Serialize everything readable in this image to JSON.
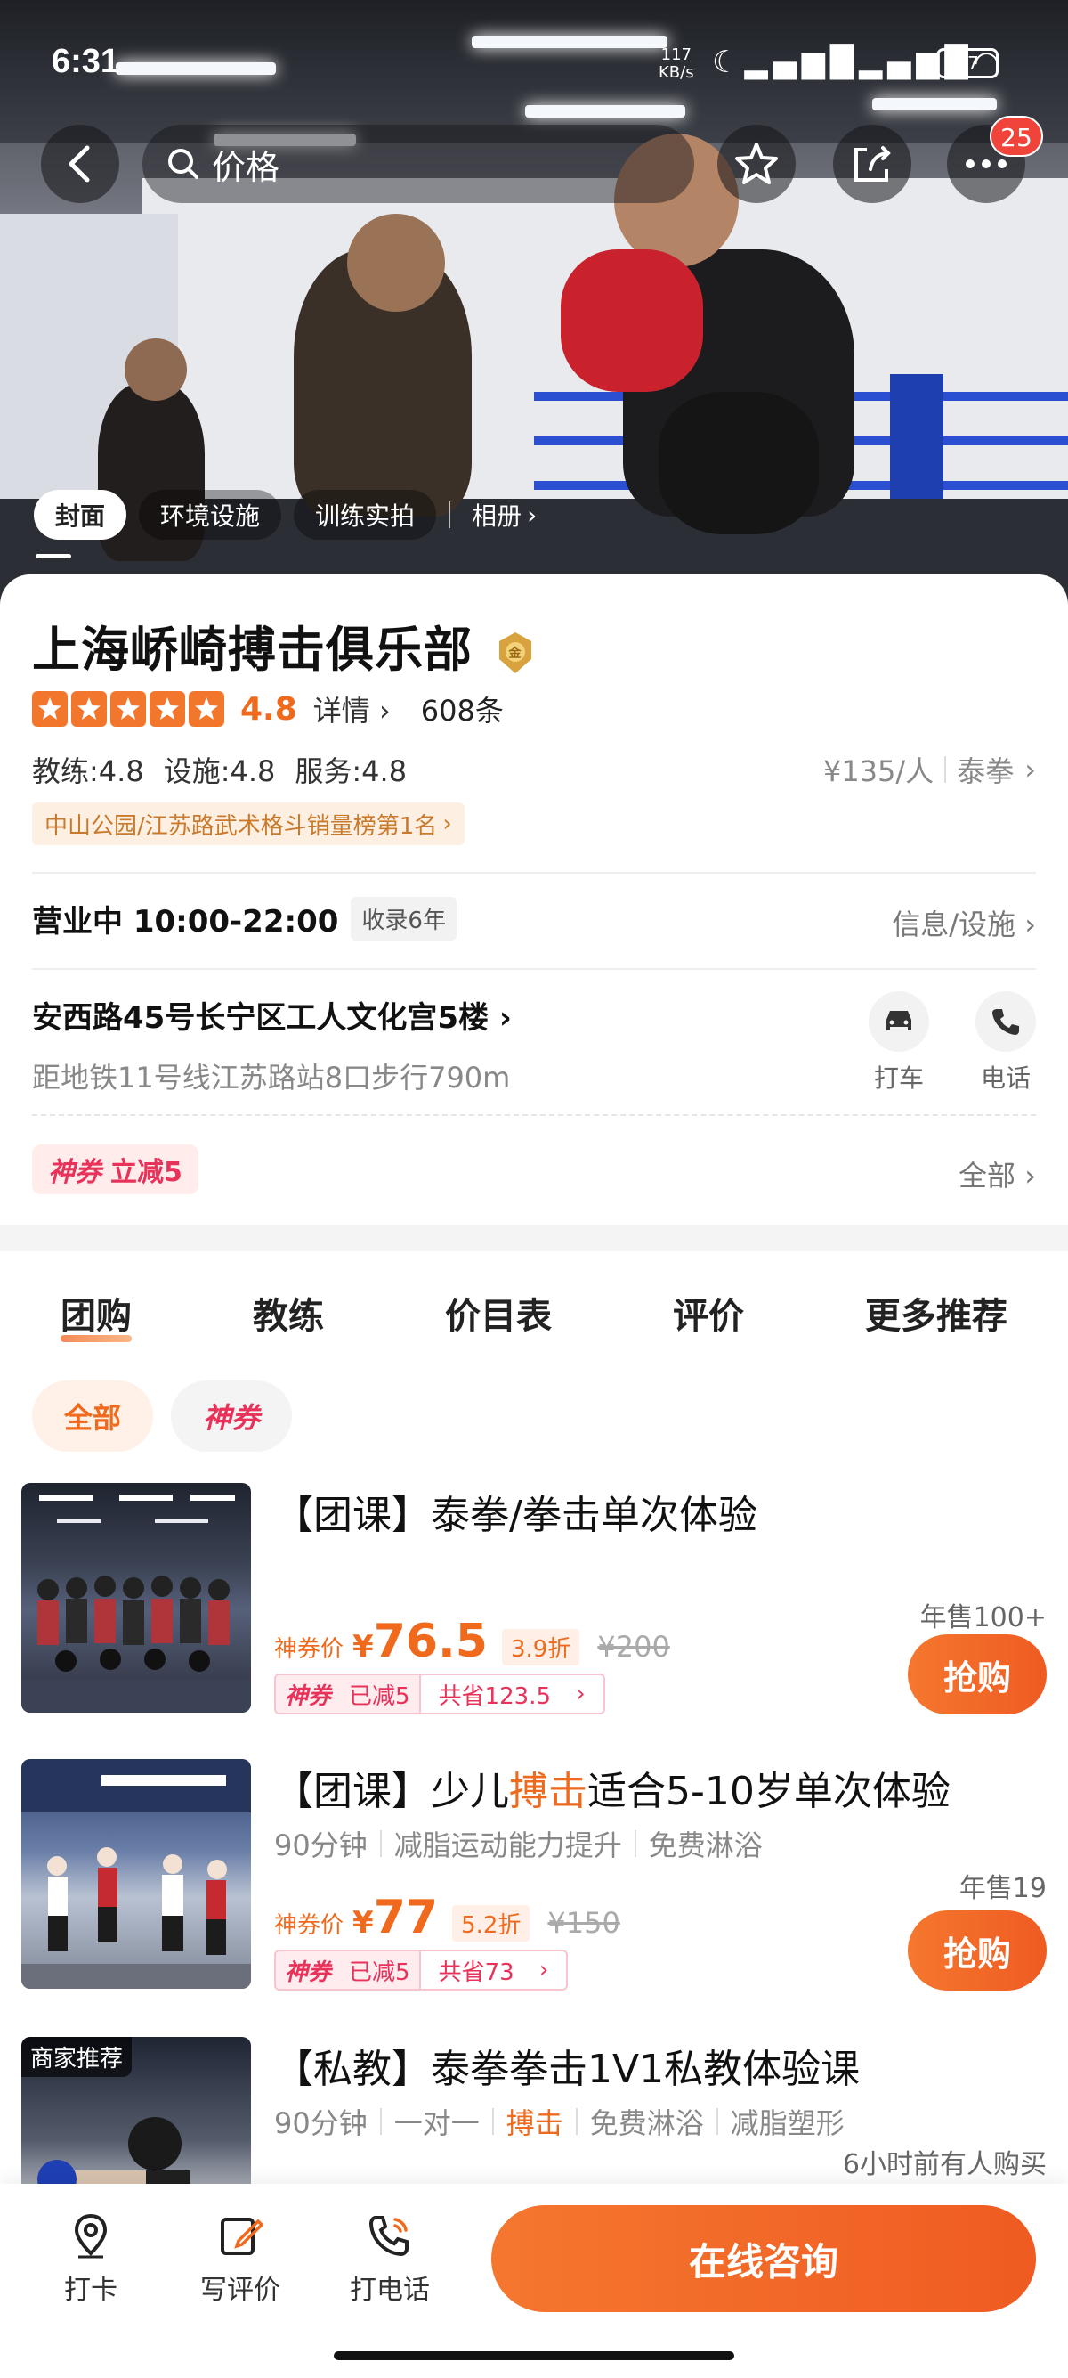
{
  "status": {
    "time": "6:31",
    "net_speed": "117",
    "net_unit": "KB/s",
    "battery": "47"
  },
  "topbar": {
    "search_text": "价格",
    "notif_count": "25"
  },
  "albums": {
    "tabs": [
      "封面",
      "环境设施",
      "训练实拍"
    ],
    "album_link": "相册"
  },
  "shop": {
    "name": "上海峤崎搏击俱乐部",
    "score": "4.8",
    "detail_link": "详情",
    "review_count": "608条",
    "sub_scores": [
      "教练:4.8",
      "设施:4.8",
      "服务:4.8"
    ],
    "price": "¥135/人",
    "category": "泰拳",
    "rank": "中山公园/江苏路武术格斗销量榜第1名"
  },
  "hours": {
    "status": "营业中 10:00-22:00",
    "tag": "收录6年",
    "info_link": "信息/设施"
  },
  "address": {
    "line": "安西路45号长宁区工人文化宫5楼",
    "metro": "距地铁11号线江苏路站8口步行790m",
    "taxi": "打车",
    "phone": "电话"
  },
  "coupon": {
    "brand": "神券",
    "text": "立减5",
    "all_link": "全部"
  },
  "tabs": [
    "团购",
    "教练",
    "价目表",
    "评价",
    "更多推荐"
  ],
  "filters": {
    "all": "全部",
    "shen": "神券"
  },
  "deals": [
    {
      "title": "【团课】泰拳/拳击单次体验",
      "price_label": "神券价",
      "yen": "¥",
      "price": "76.5",
      "discount": "3.9折",
      "original": "¥200",
      "save_brand": "神券",
      "saved": "已减5",
      "total_save": "共省123.5",
      "sold": "年售100+",
      "buy": "抢购"
    },
    {
      "title_a": "【团课】少儿",
      "title_hl": "搏击",
      "title_b": "适合5-10岁单次体验",
      "tags": [
        "90分钟",
        "减脂运动能力提升",
        "免费淋浴"
      ],
      "price_label": "神券价",
      "yen": "¥",
      "price": "77",
      "discount": "5.2折",
      "original": "¥150",
      "save_brand": "神券",
      "saved": "已减5",
      "total_save": "共省73",
      "sold": "年售19",
      "buy": "抢购"
    },
    {
      "title": "【私教】泰拳拳击1V1私教体验课",
      "merchant_tag": "商家推荐",
      "tags": [
        "90分钟",
        "一对一",
        "搏击",
        "免费淋浴",
        "减脂塑形"
      ],
      "recent": "6小时前有人购买"
    }
  ],
  "bottombar": {
    "checkin": "打卡",
    "review": "写评价",
    "call": "打电话",
    "consult": "在线咨询"
  },
  "colors": {
    "accent": "#f06a1e",
    "shen": "#e9325a"
  }
}
